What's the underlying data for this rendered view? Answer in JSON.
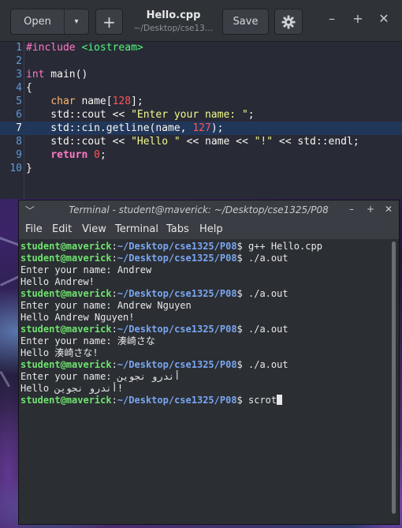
{
  "editor": {
    "open_label": "Open",
    "open_arrow": "▾",
    "new_tab_label": "+",
    "title": "Hello.cpp",
    "subtitle": "~/Desktop/cse13…",
    "save_label": "Save",
    "menu_icon": "gear-icon",
    "minimize": "–",
    "maximize": "+",
    "close": "✕",
    "current_line": 7,
    "lines": [
      {
        "n": "1",
        "t": [
          {
            "c": "pre",
            "v": "#include "
          },
          {
            "c": "inc",
            "v": "<iostream>"
          }
        ]
      },
      {
        "n": "2",
        "t": []
      },
      {
        "n": "3",
        "t": [
          {
            "c": "kw",
            "v": "int"
          },
          {
            "c": "",
            "v": " main()"
          }
        ]
      },
      {
        "n": "4",
        "t": [
          {
            "c": "",
            "v": "{"
          }
        ]
      },
      {
        "n": "5",
        "t": [
          {
            "c": "",
            "v": "    "
          },
          {
            "c": "type",
            "v": "char"
          },
          {
            "c": "",
            "v": " name["
          },
          {
            "c": "num",
            "v": "128"
          },
          {
            "c": "",
            "v": "];"
          }
        ]
      },
      {
        "n": "6",
        "t": [
          {
            "c": "",
            "v": "    std::cout << "
          },
          {
            "c": "str",
            "v": "\"Enter your name: \""
          },
          {
            "c": "",
            "v": ";"
          }
        ]
      },
      {
        "n": "7",
        "t": [
          {
            "c": "",
            "v": "    std::cin.getline(name, "
          },
          {
            "c": "num",
            "v": "127"
          },
          {
            "c": "",
            "v": ");"
          }
        ]
      },
      {
        "n": "8",
        "t": [
          {
            "c": "",
            "v": "    std::cout << "
          },
          {
            "c": "str",
            "v": "\"Hello \""
          },
          {
            "c": "",
            "v": " << name << "
          },
          {
            "c": "str",
            "v": "\"!\""
          },
          {
            "c": "",
            "v": " << std::endl;"
          }
        ]
      },
      {
        "n": "9",
        "t": [
          {
            "c": "",
            "v": "    "
          },
          {
            "c": "ret",
            "v": "return"
          },
          {
            "c": "",
            "v": " "
          },
          {
            "c": "num",
            "v": "0"
          },
          {
            "c": "",
            "v": ";"
          }
        ]
      },
      {
        "n": "10",
        "t": [
          {
            "c": "",
            "v": "}"
          }
        ]
      }
    ]
  },
  "terminal": {
    "title": "Terminal - student@maverick: ~/Desktop/cse1325/P08",
    "menu": [
      "File",
      "Edit",
      "View",
      "Terminal",
      "Tabs",
      "Help"
    ],
    "prompt_user": "student@maverick",
    "prompt_path": "~/Desktop/cse1325/P08",
    "lines": [
      {
        "type": "prompt",
        "cmd": "g++ Hello.cpp"
      },
      {
        "type": "prompt",
        "cmd": "./a.out"
      },
      {
        "type": "out",
        "text": "Enter your name: Andrew"
      },
      {
        "type": "out",
        "text": "Hello Andrew!"
      },
      {
        "type": "prompt",
        "cmd": "./a.out"
      },
      {
        "type": "out",
        "text": "Enter your name: Andrew Nguyen"
      },
      {
        "type": "out",
        "text": "Hello Andrew Nguyen!"
      },
      {
        "type": "prompt",
        "cmd": "./a.out"
      },
      {
        "type": "out",
        "text": "Enter your name: 湊崎さな"
      },
      {
        "type": "out",
        "text": "Hello 湊崎さな!"
      },
      {
        "type": "prompt",
        "cmd": "./a.out"
      },
      {
        "type": "out",
        "text": "Enter your name: أندرو نجوين"
      },
      {
        "type": "out",
        "text": "Hello أندرو نجوين!"
      },
      {
        "type": "prompt",
        "cmd": "scrot",
        "cursor": true
      }
    ]
  }
}
